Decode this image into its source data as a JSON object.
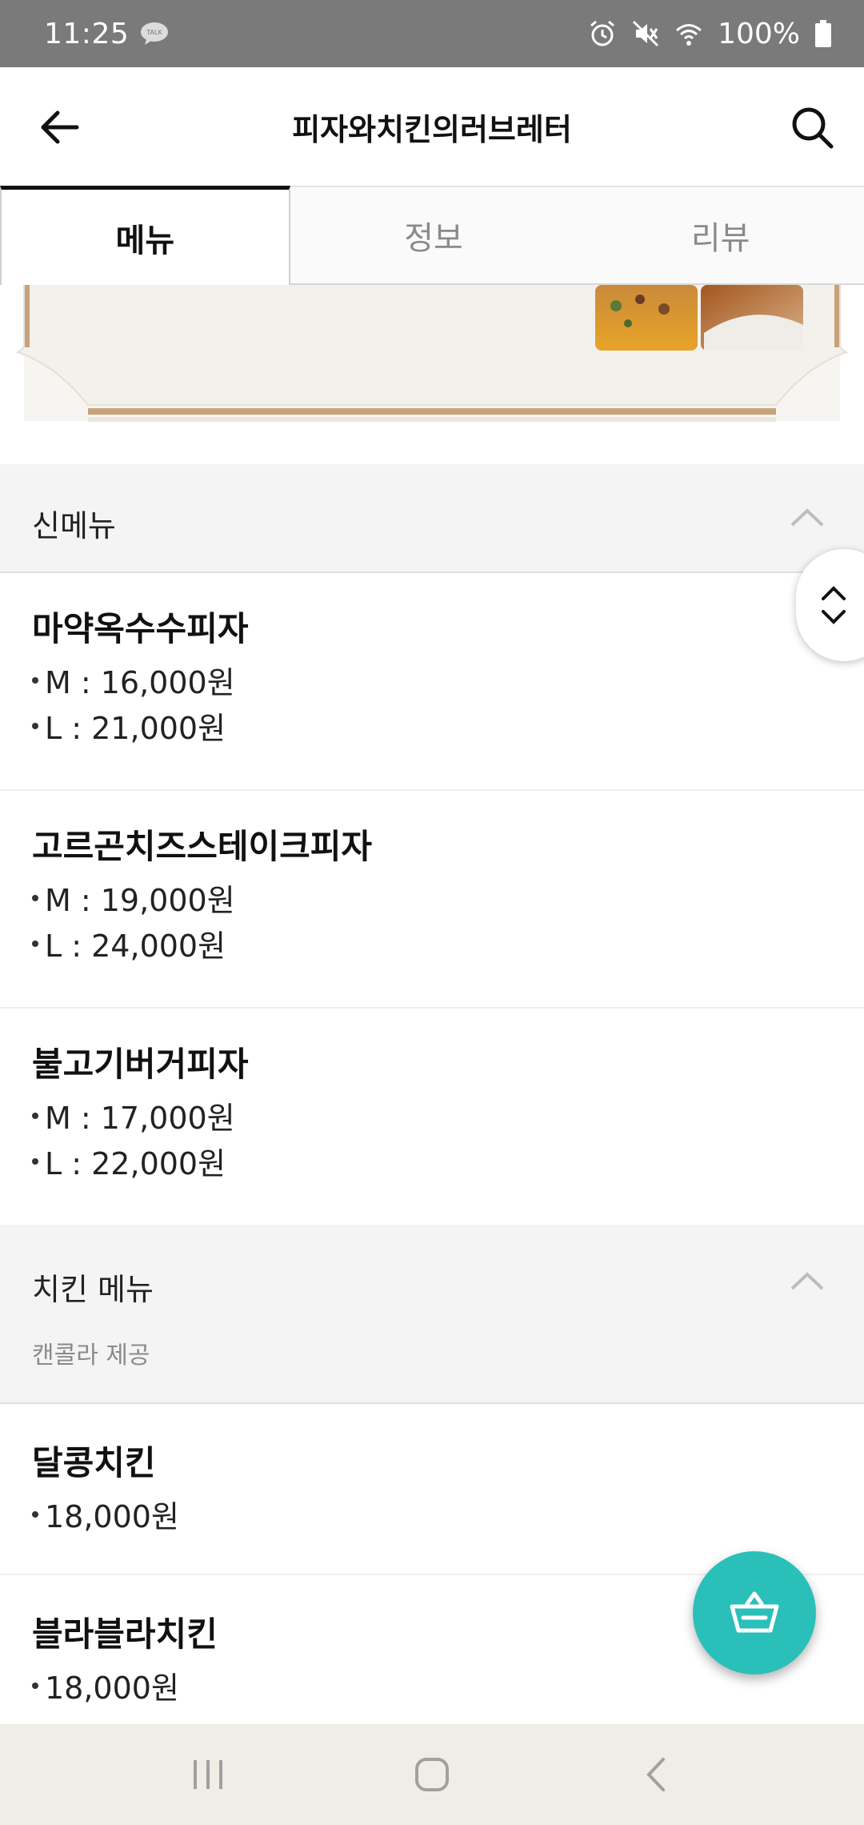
{
  "status_bar": {
    "time": "11:25",
    "battery": "100%",
    "icons": [
      "talk-icon",
      "alarm-icon",
      "mute-icon",
      "wifi-icon",
      "battery-icon"
    ]
  },
  "app_bar": {
    "title": "피자와치킨의러브레터",
    "icons": [
      "back-arrow-icon",
      "search-icon"
    ]
  },
  "tabs": [
    {
      "label": "메뉴",
      "active": true
    },
    {
      "label": "정보",
      "active": false
    },
    {
      "label": "리뷰",
      "active": false
    }
  ],
  "sections": [
    {
      "title": "신메뉴",
      "subtitle": "",
      "items": [
        {
          "name": "마약옥수수피자",
          "prices": [
            "M : 16,000원",
            "L : 21,000원"
          ]
        },
        {
          "name": "고르곤치즈스테이크피자",
          "prices": [
            "M : 19,000원",
            "L : 24,000원"
          ]
        },
        {
          "name": "불고기버거피자",
          "prices": [
            "M : 17,000원",
            "L : 22,000원"
          ]
        }
      ]
    },
    {
      "title": "치킨 메뉴",
      "subtitle": "캔콜라 제공",
      "items": [
        {
          "name": "달콩치킨",
          "prices": [
            "18,000원"
          ]
        },
        {
          "name": "블라블라치킨",
          "prices": [
            "18,000원"
          ]
        }
      ]
    }
  ],
  "colors": {
    "status_bar": "#7a7a7a",
    "accent_fab": "#2bbfb9",
    "section_bg": "#f4f4f4",
    "nav_bar": "#efede6",
    "banner_frame": "#c8a27a"
  },
  "fab": {
    "icon": "shopping-basket-icon"
  },
  "nav_bar": {
    "icons": [
      "recent-apps-icon",
      "home-icon",
      "back-nav-icon"
    ]
  }
}
